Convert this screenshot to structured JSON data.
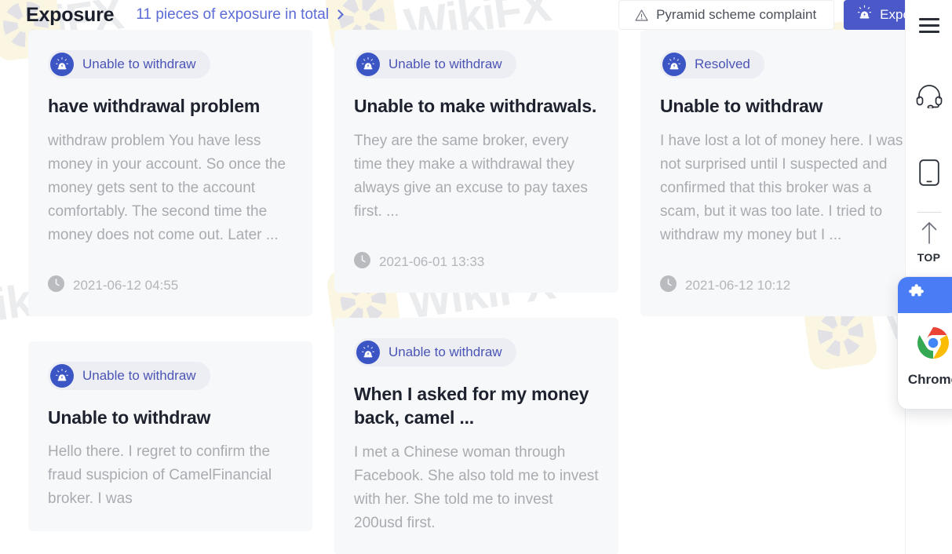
{
  "header": {
    "title": "Exposure",
    "subtitle": "11 pieces of exposure in total",
    "chevron_icon": "chevron-right-icon",
    "complaint_button": {
      "label": "Pyramid scheme complaint",
      "icon": "warning-triangle-icon"
    },
    "exposure_button": {
      "label": "Exposure",
      "icon": "alarm-siren-icon"
    }
  },
  "colors": {
    "accent": "#4a58c8",
    "link": "#5c6bd6",
    "badge_text": "#4a55b5",
    "badge_bg": "#ededf4",
    "card_bg": "#f7f8fa",
    "title_text": "#1d222e",
    "body_text": "#a9abb0",
    "time_text": "#b3b5ba",
    "chrome_blue": "#4a7cf6"
  },
  "watermark": {
    "text": "WikiFX",
    "logo_icon": "wikifx-logo-icon"
  },
  "columns": [
    {
      "cards": [
        {
          "badge_icon": "alarm-siren-icon",
          "badge": "Unable to withdraw",
          "title": "have withdrawal problem",
          "body": "withdraw problem You have less money in your account. So once the money gets sent to the account comfortably. The second time the money does not come out.  Later ...",
          "time_icon": "clock-icon",
          "time": "2021-06-12 04:55"
        },
        {
          "badge_icon": "alarm-siren-icon",
          "badge": "Unable to withdraw",
          "title": "Unable to withdraw",
          "body": "Hello there. I regret to confirm the fraud suspicion of CamelFinancial broker. I was",
          "time_icon": "clock-icon",
          "time": ""
        }
      ]
    },
    {
      "cards": [
        {
          "badge_icon": "alarm-siren-icon",
          "badge": "Unable to withdraw",
          "title": "Unable to make withdrawals.",
          "body": "They are the same broker, every time they make a withdrawal they always give an excuse to pay taxes first. ...",
          "time_icon": "clock-icon",
          "time": "2021-06-01 13:33"
        },
        {
          "badge_icon": "alarm-siren-icon",
          "badge": "Unable to withdraw",
          "title": "When I asked for my money back, camel ...",
          "body": "I met a Chinese woman through Facebook. She also told me to invest with her. She told me to invest 200usd first.",
          "time_icon": "clock-icon",
          "time": ""
        }
      ]
    },
    {
      "cards": [
        {
          "badge_icon": "alarm-siren-icon",
          "badge": "Resolved",
          "title": "Unable to withdraw",
          "body": "I have lost a lot of money here. I was not surprised until I suspected and confirmed that this broker was a scam, but it was too late. I tried to withdraw my money but I ...",
          "time_icon": "clock-icon",
          "time": "2021-06-12 10:12"
        }
      ]
    }
  ],
  "right_rail": {
    "menu_icon": "hamburger-menu-icon",
    "support_icon": "headset-icon",
    "mobile_icon": "mobile-phone-icon",
    "top_icon": "arrow-up-icon",
    "top_label": "TOP"
  },
  "chrome_popup": {
    "puzzle_icon": "puzzle-piece-icon",
    "logo_icon": "chrome-logo-icon",
    "label": "Chrome"
  }
}
